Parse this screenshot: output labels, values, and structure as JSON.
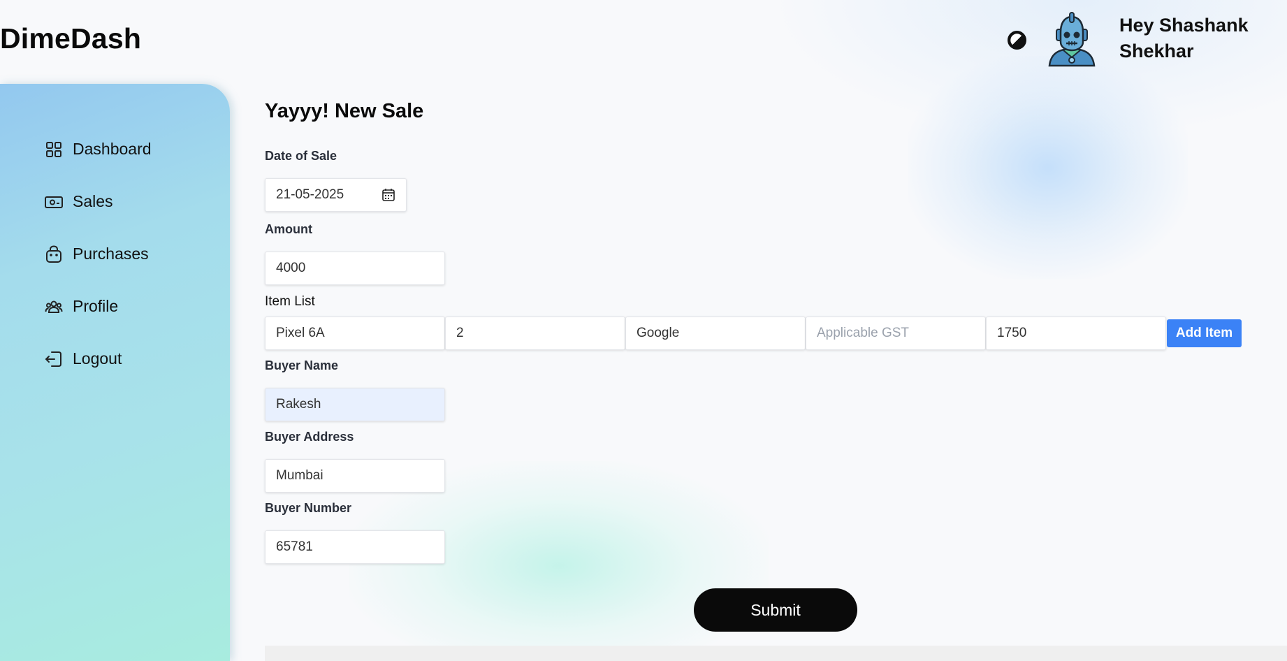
{
  "app": {
    "brand": "DimeDash"
  },
  "header": {
    "greeting": "Hey Shashank Shekhar",
    "theme_icon": "half-circle-contrast-icon",
    "avatar_icon": "robot-avatar"
  },
  "sidebar": {
    "items": [
      {
        "label": "Dashboard",
        "icon": "grid-icon"
      },
      {
        "label": "Sales",
        "icon": "cash-icon"
      },
      {
        "label": "Purchases",
        "icon": "shopping-bag-icon"
      },
      {
        "label": "Profile",
        "icon": "users-icon"
      },
      {
        "label": "Logout",
        "icon": "logout-icon"
      }
    ]
  },
  "form": {
    "title": "Yayyy! New Sale",
    "date": {
      "label": "Date of Sale",
      "value": "21-05-2025",
      "icon": "calendar-icon"
    },
    "amount": {
      "label": "Amount",
      "value": "4000"
    },
    "items": {
      "label": "Item List",
      "name": {
        "value": "Pixel 6A"
      },
      "quantity": {
        "value": "2"
      },
      "brand": {
        "value": "Google"
      },
      "gst": {
        "value": "",
        "placeholder": "Applicable GST"
      },
      "price": {
        "value": "1750"
      },
      "add_button": "Add Item"
    },
    "buyer_name": {
      "label": "Buyer Name",
      "value": "Rakesh"
    },
    "buyer_address": {
      "label": "Buyer Address",
      "value": "Mumbai"
    },
    "buyer_number": {
      "label": "Buyer Number",
      "value": "65781"
    },
    "submit": "Submit"
  },
  "colors": {
    "accent": "#3b82f6",
    "submit_bg": "#0a0a0a",
    "sidebar_gradient": [
      "#93c8ef",
      "#a8ecdf"
    ]
  }
}
